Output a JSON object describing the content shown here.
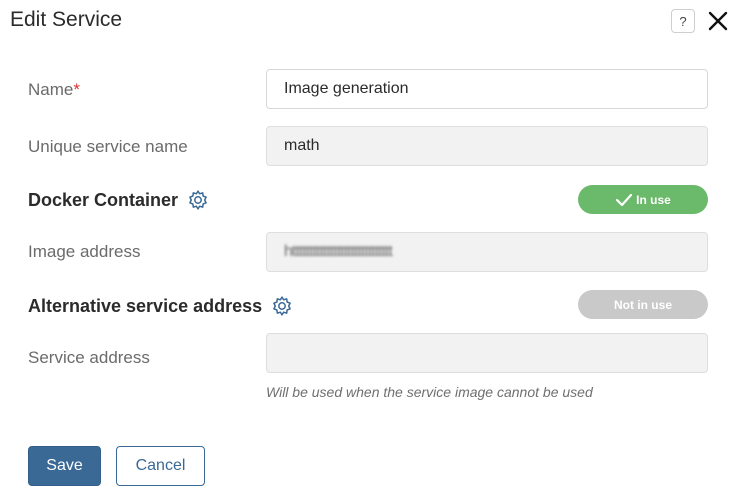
{
  "dialog": {
    "title": "Edit Service"
  },
  "header": {
    "help_label": "?"
  },
  "name": {
    "label": "Name",
    "required_mark": "*",
    "value": "Image generation"
  },
  "unique_name": {
    "label": "Unique service name",
    "value": "math"
  },
  "docker": {
    "section_label": "Docker Container",
    "toggle_label": "In use",
    "toggle_state": "on"
  },
  "image_address": {
    "label": "Image address",
    "value": "httttttttttttttttttttttttttttt"
  },
  "alternative": {
    "section_label": "Alternative service address",
    "toggle_label": "Not in use",
    "toggle_state": "off"
  },
  "service_address": {
    "label": "Service address",
    "value": "",
    "hint": "Will be used when the service image cannot be used"
  },
  "footer": {
    "save_label": "Save",
    "cancel_label": "Cancel"
  },
  "colors": {
    "accent": "#3a6996",
    "toggle_on": "#6bb96b",
    "toggle_off": "#c9c9c9",
    "required": "#d9352e"
  },
  "icons": {
    "help": "help-icon",
    "close": "close-icon",
    "settings": "gear-icon",
    "check": "check-icon"
  }
}
